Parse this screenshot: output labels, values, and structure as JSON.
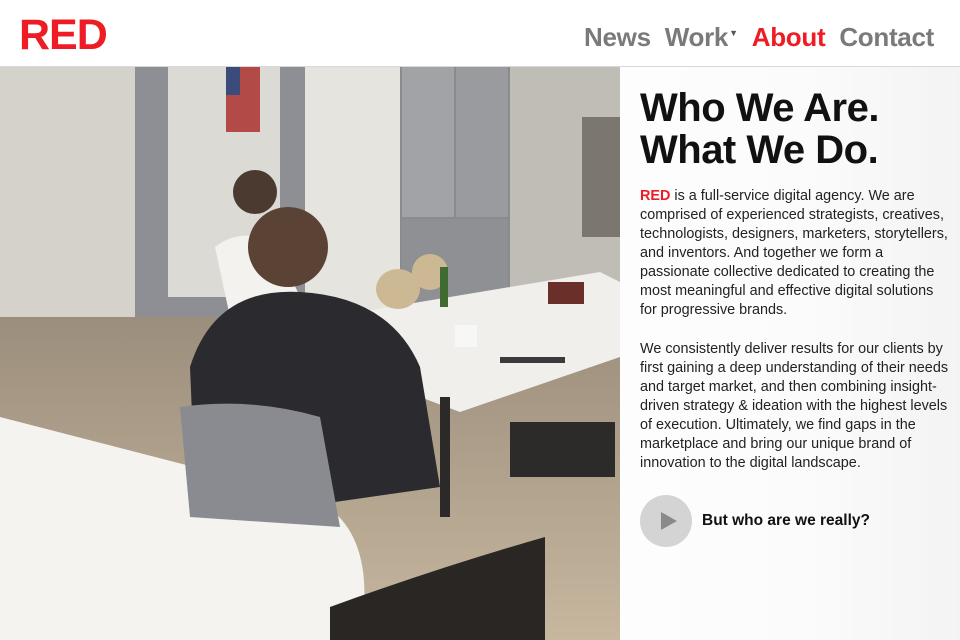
{
  "header": {
    "logo": "RED",
    "nav": [
      {
        "label": "News",
        "active": false
      },
      {
        "label": "Work",
        "active": false,
        "has_dropdown": true
      },
      {
        "label": "About",
        "active": true
      },
      {
        "label": "Contact",
        "active": false
      }
    ]
  },
  "about": {
    "headline_line1": "Who We Are.",
    "headline_line2": "What We Do.",
    "para1_brand": "RED",
    "para1_text": " is a full-service digital agency. We are comprised of experienced strategists, creatives, technologists, designers, marketers, storytellers, and inventors. And together we form a passionate collective dedicated to creating the most meaningful and effective digital solutions for progressive brands.",
    "para2_text": "We consistently deliver results for our clients by first gaining a deep understanding of their needs and target market, and then combining insight-driven strategy & ideation with the highest levels of execution. Ultimately, we find gaps in the marketplace and bring our unique brand of innovation to the digital landscape.",
    "video_cta": "But who are we really?"
  },
  "colors": {
    "brand_red": "#ee1c24",
    "nav_gray": "#7a7a7a",
    "text_dark": "#111111"
  },
  "icons": {
    "play": "play-icon",
    "dropdown": "caret-down-icon"
  }
}
